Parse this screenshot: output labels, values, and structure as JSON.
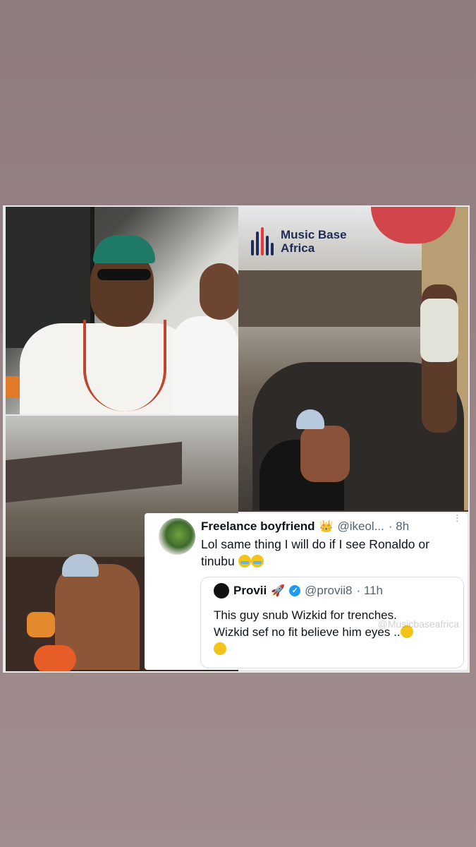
{
  "logo": {
    "line1": "Music Base",
    "line2": "Africa",
    "brand_color": "#1f2b57",
    "accent_color": "#e23b3b"
  },
  "tweet": {
    "name": "Freelance boyfriend",
    "badge_icon": "crown",
    "handle": "@ikeol...",
    "time": "· 8h",
    "text_line1": "Lol same thing I will do if I see Ronaldo or",
    "text_line2": "tinubu",
    "text_emoji": "crying-emoji",
    "quote": {
      "name": "Provii",
      "badge_icon": "rocket",
      "handle": "@provii8",
      "time": "· 11h",
      "text_line1": "This guy snub Wizkid for trenches.",
      "text_line2": "Wizkid sef no fit believe him eyes ..",
      "watermark": "@Musicbaseafrica"
    }
  }
}
